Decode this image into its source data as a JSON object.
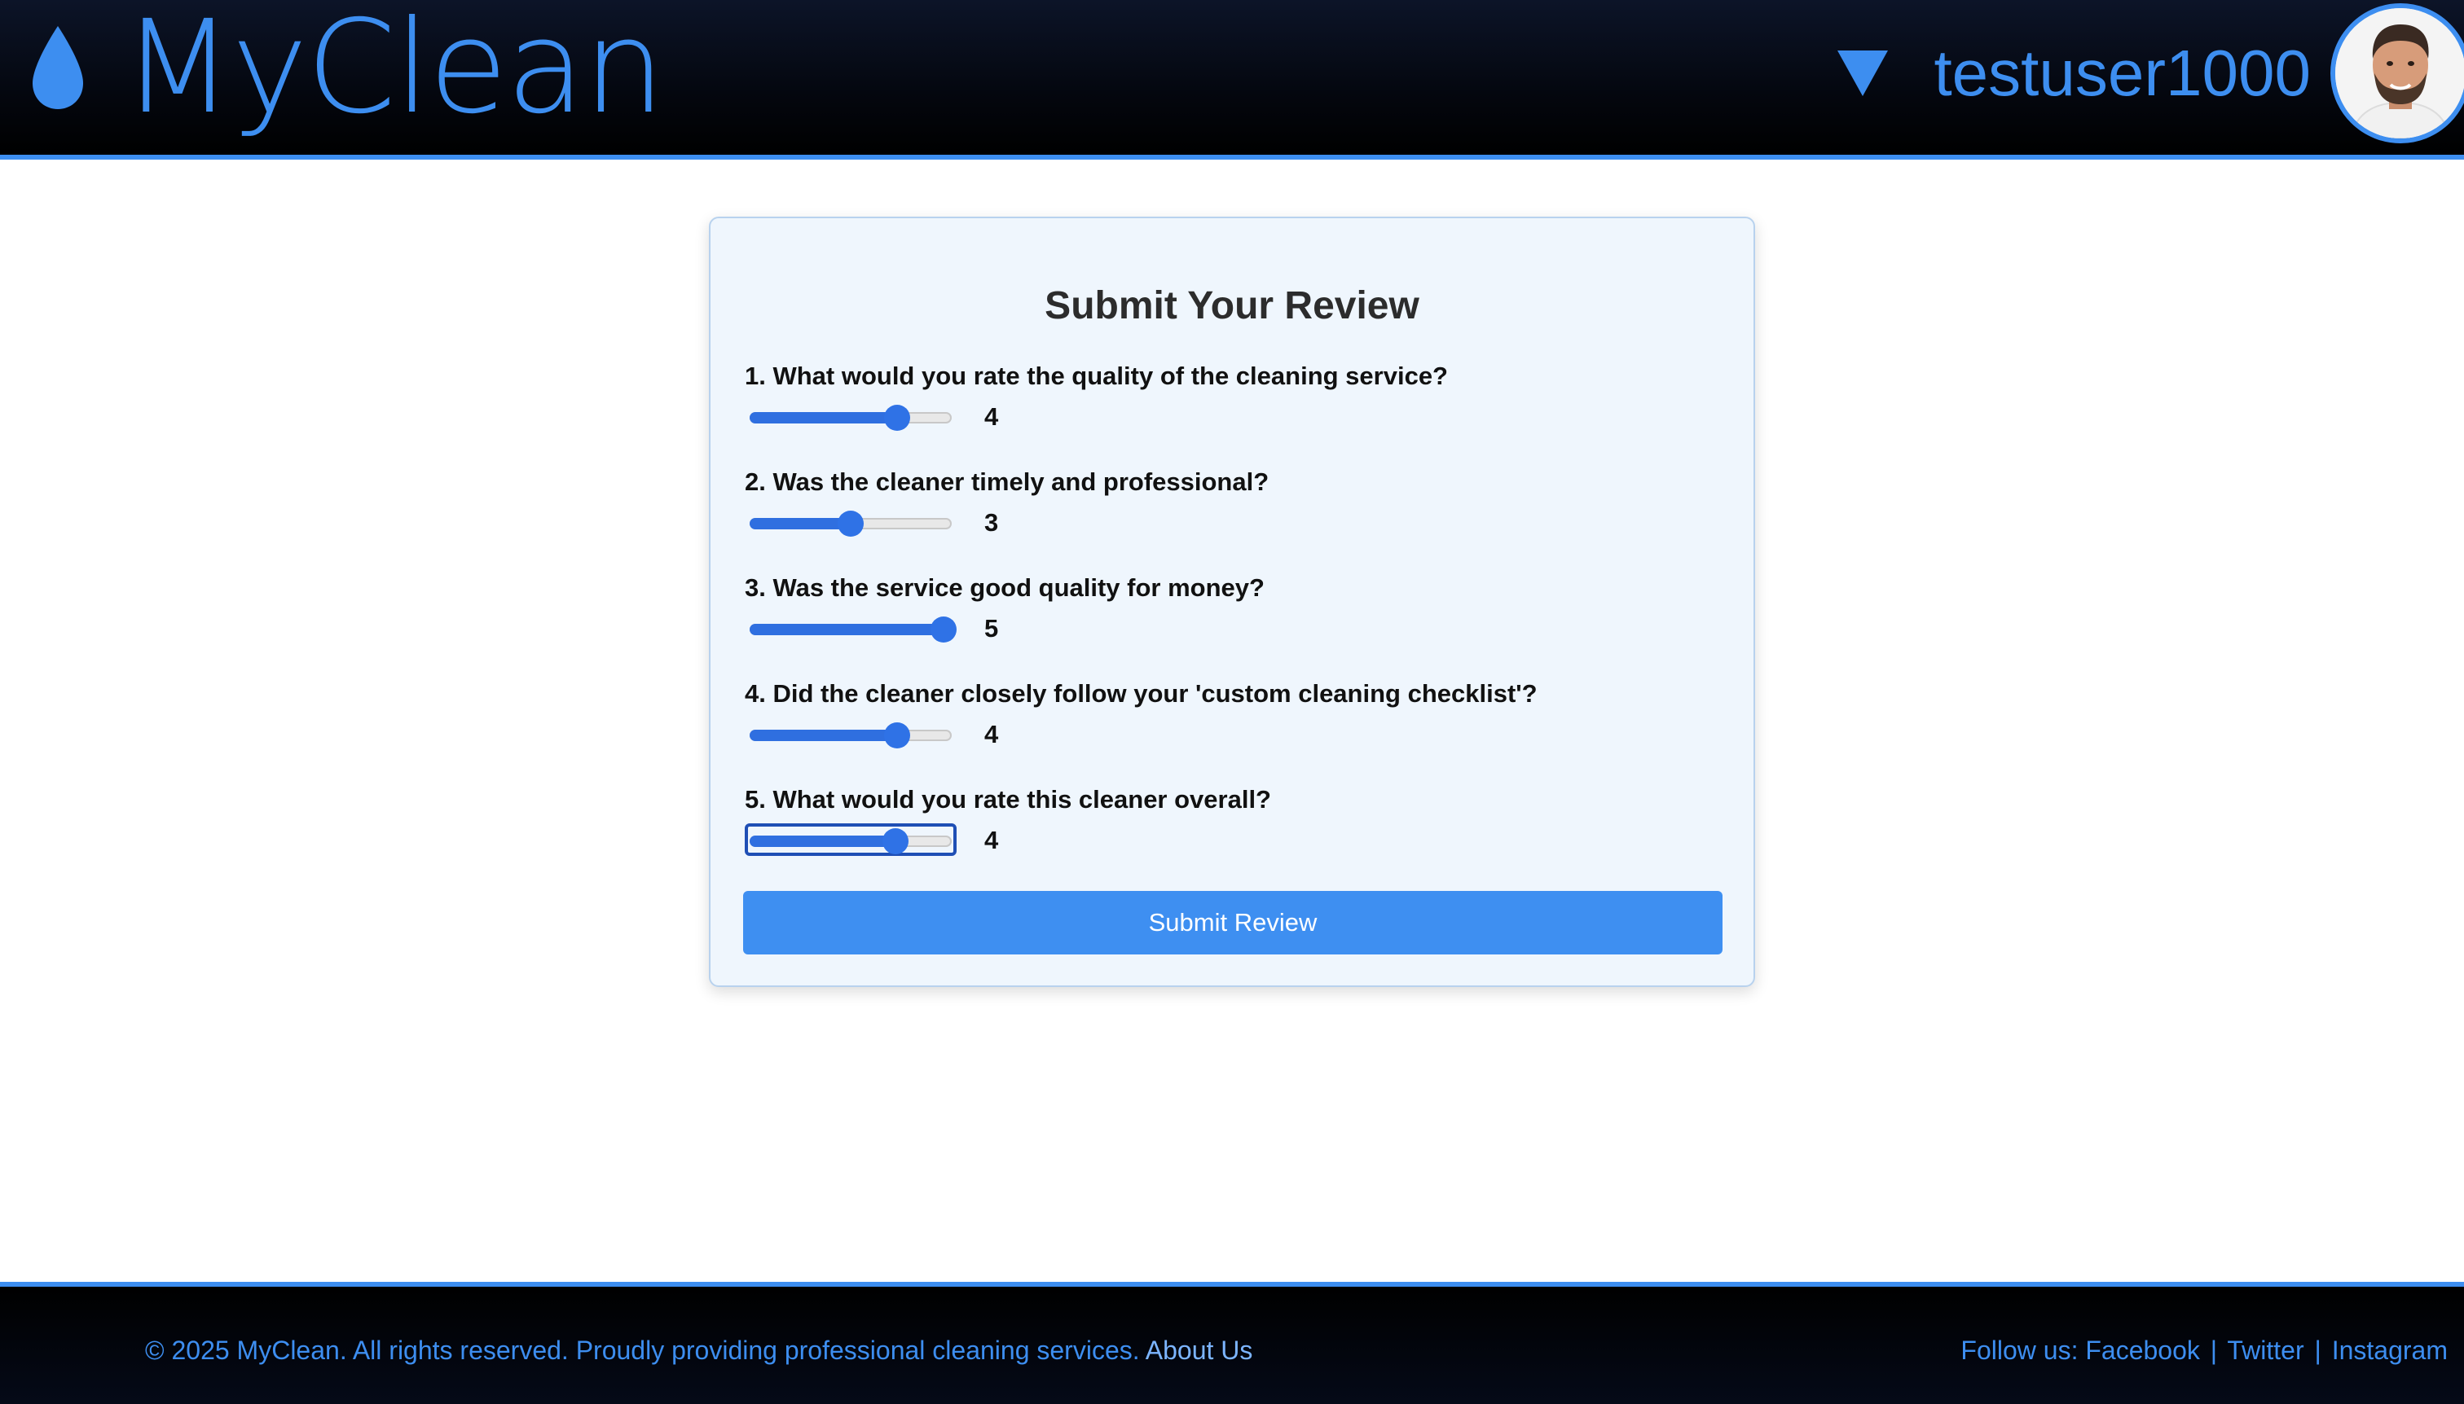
{
  "header": {
    "logo_text": "MyClean",
    "username": "testuser1000",
    "logo_icon": "droplet-icon",
    "menu_icon": "caret-down-icon",
    "accent_color": "#3d8ef0"
  },
  "review": {
    "title": "Submit Your Review",
    "questions": [
      {
        "label": "1. What would you rate the quality of the cleaning service?",
        "value": "4"
      },
      {
        "label": "2. Was the cleaner timely and professional?",
        "value": "3"
      },
      {
        "label": "3. Was the service good quality for money?",
        "value": "5"
      },
      {
        "label": "4. Did the cleaner closely follow your 'custom cleaning checklist'?",
        "value": "4"
      },
      {
        "label": "5. What would you rate this cleaner overall?",
        "value": "4"
      }
    ],
    "slider_min": 1,
    "slider_max": 5,
    "submit_label": "Submit Review"
  },
  "footer": {
    "copyright": "© 2025 MyClean. All rights reserved. Proudly providing professional cleaning services.",
    "about_link": "About Us",
    "follow_label": "Follow us:",
    "social": [
      "Facebook",
      "Twitter",
      "Instagram"
    ],
    "separator": "|"
  }
}
